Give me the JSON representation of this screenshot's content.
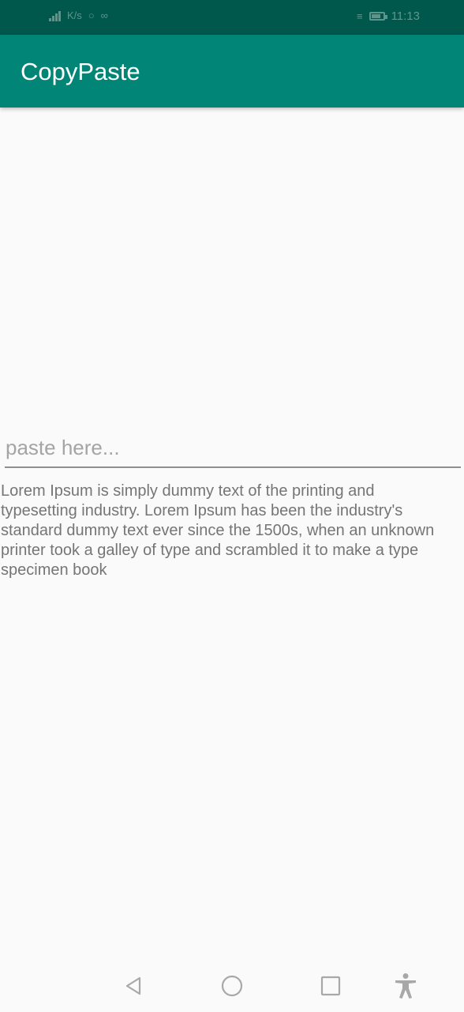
{
  "status_bar": {
    "time": "11:13",
    "indicators": [
      "signal-icon",
      "network-speed-icon",
      "notification-icon",
      "wifi-icon",
      "vibrate-icon",
      "battery-icon"
    ],
    "network_speed": "K/s",
    "battery_level": 0.82
  },
  "app_bar": {
    "title": "CopyPaste",
    "color": "#008577",
    "status_color": "#00574b"
  },
  "paste_input": {
    "value": "",
    "placeholder": "paste here..."
  },
  "body_text": "Lorem Ipsum is simply dummy text of the printing and typesetting industry. Lorem Ipsum has been the industry's standard dummy text ever since the 1500s, when an unknown printer took a galley of type and scrambled it to make a type specimen book",
  "nav_bar": {
    "buttons": [
      "back-icon",
      "home-icon",
      "recents-icon",
      "accessibility-icon"
    ]
  }
}
